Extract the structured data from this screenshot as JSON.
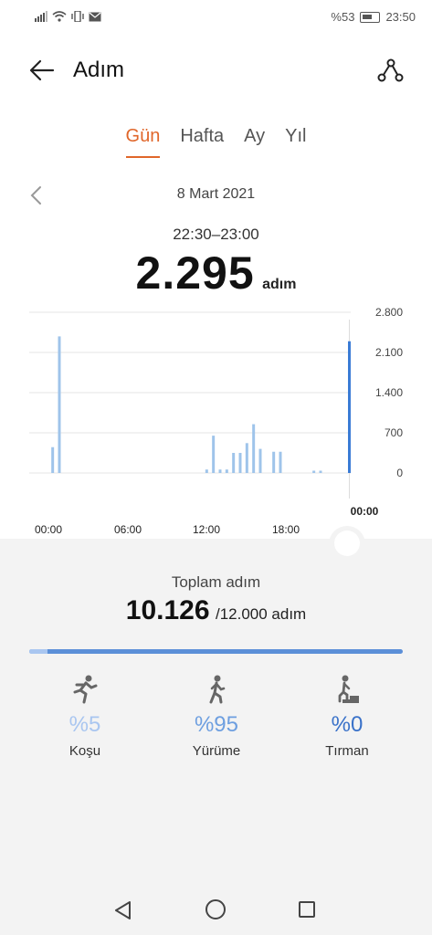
{
  "status_bar": {
    "battery": "%53",
    "time": "23:50"
  },
  "header": {
    "title": "Adım"
  },
  "tabs": [
    {
      "label": "Gün",
      "active": true
    },
    {
      "label": "Hafta",
      "active": false
    },
    {
      "label": "Ay",
      "active": false
    },
    {
      "label": "Yıl",
      "active": false
    }
  ],
  "date": "8 Mart 2021",
  "selection": {
    "time_range": "22:30–23:00",
    "value": "2.295",
    "unit": "adım"
  },
  "chart_data": {
    "type": "bar",
    "x_tick_labels": [
      "00:00",
      "06:00",
      "12:00",
      "18:00"
    ],
    "x_selected_label": "00:00",
    "y_tick_labels": [
      "2.800",
      "2.100",
      "1.400",
      "700",
      "0"
    ],
    "ylim": [
      0,
      2800
    ],
    "slot_count": 48,
    "values": [
      0,
      0,
      0,
      450,
      2380,
      0,
      0,
      0,
      0,
      0,
      0,
      0,
      0,
      0,
      0,
      0,
      0,
      0,
      0,
      0,
      0,
      0,
      0,
      0,
      0,
      60,
      650,
      60,
      60,
      350,
      350,
      520,
      850,
      420,
      0,
      370,
      370,
      0,
      0,
      0,
      0,
      40,
      40,
      0,
      0,
      0,
      0,
      0,
      0,
      0,
      0,
      0,
      0,
      0,
      0,
      0,
      0,
      0,
      0,
      0,
      0,
      0,
      0,
      0,
      0,
      0,
      0,
      0,
      0,
      0,
      0,
      0,
      0,
      0,
      0,
      0,
      0,
      0,
      0,
      0,
      0,
      0,
      0,
      0,
      0,
      0,
      0,
      0
    ],
    "series_values_by_slot": [
      0,
      0,
      0,
      450,
      2380,
      0,
      0,
      0,
      0,
      0,
      0,
      0,
      0,
      0,
      0,
      0,
      0,
      0,
      0,
      0,
      0,
      0,
      0,
      0,
      0,
      0,
      60,
      650,
      60,
      60,
      350,
      350,
      520,
      850,
      420,
      0,
      370,
      370,
      0,
      0,
      0,
      0,
      40,
      40,
      0,
      0,
      0,
      0,
      0,
      0
    ],
    "half_hour_values": [
      450,
      2380,
      60,
      650,
      60,
      60,
      350,
      350,
      520,
      850,
      420,
      370,
      370,
      40,
      40,
      120,
      160,
      80,
      90,
      190,
      2295
    ],
    "selected_value": 2295,
    "colors": {
      "bar": "#9fc4ea",
      "selected_bar": "#3a7bd5",
      "grid": "#e6e6e6"
    }
  },
  "summary": {
    "label": "Toplam adım",
    "value": "10.126",
    "goal": "/12.000 adım",
    "progress": 0.05
  },
  "activities": [
    {
      "name": "run",
      "pct": "%5",
      "label": "Koşu",
      "color": "#a9c6f0"
    },
    {
      "name": "walk",
      "pct": "%95",
      "label": "Yürüme",
      "color": "#6e9fe0"
    },
    {
      "name": "climb",
      "pct": "%0",
      "label": "Tırman",
      "color": "#3a72c9"
    }
  ]
}
